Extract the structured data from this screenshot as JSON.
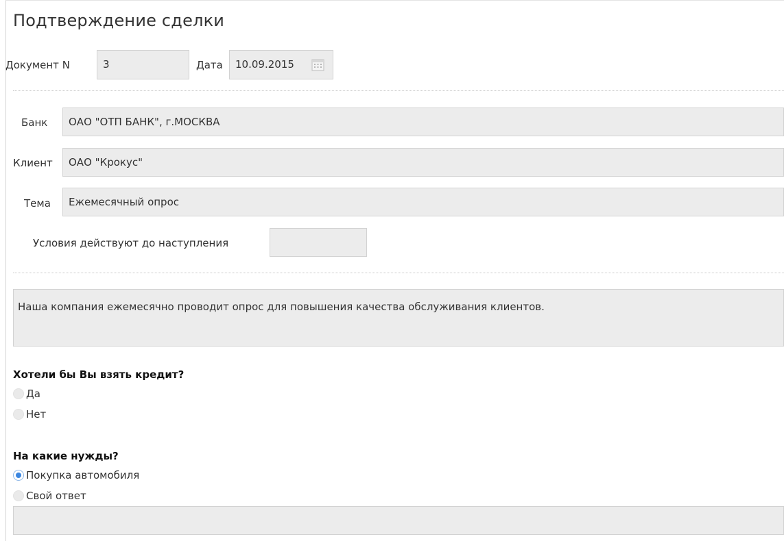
{
  "title": "Подтверждение сделки",
  "document": {
    "number_label": "Документ N",
    "number_value": "3",
    "date_label": "Дата",
    "date_value": "10.09.2015"
  },
  "bank": {
    "label": "Банк",
    "value": "ОАО \"ОТП БАНК\", г.МОСКВА"
  },
  "client": {
    "label": "Клиент",
    "value": "ОАО \"Крокус\""
  },
  "topic": {
    "label": "Тема",
    "value": "Ежемесячный опрос"
  },
  "conditions": {
    "label": "Условия действуют до наступления",
    "value": ""
  },
  "message": "Наша компания ежемесячно проводит опрос для повышения качества обслуживания клиентов.",
  "question1": {
    "text": "Хотели бы Вы взять кредит?",
    "options": [
      {
        "label": "Да",
        "checked": false
      },
      {
        "label": "Нет",
        "checked": false
      }
    ]
  },
  "question2": {
    "text": "На какие нужды?",
    "options": [
      {
        "label": "Покупка автомобиля",
        "checked": true
      },
      {
        "label": "Свой ответ",
        "checked": false
      }
    ],
    "custom_answer": ""
  },
  "colors": {
    "field_bg": "#ececec",
    "field_border": "#d2d2d2",
    "radio_accent": "#3b86e0"
  },
  "icons": {
    "date_picker": "calendar-icon"
  }
}
